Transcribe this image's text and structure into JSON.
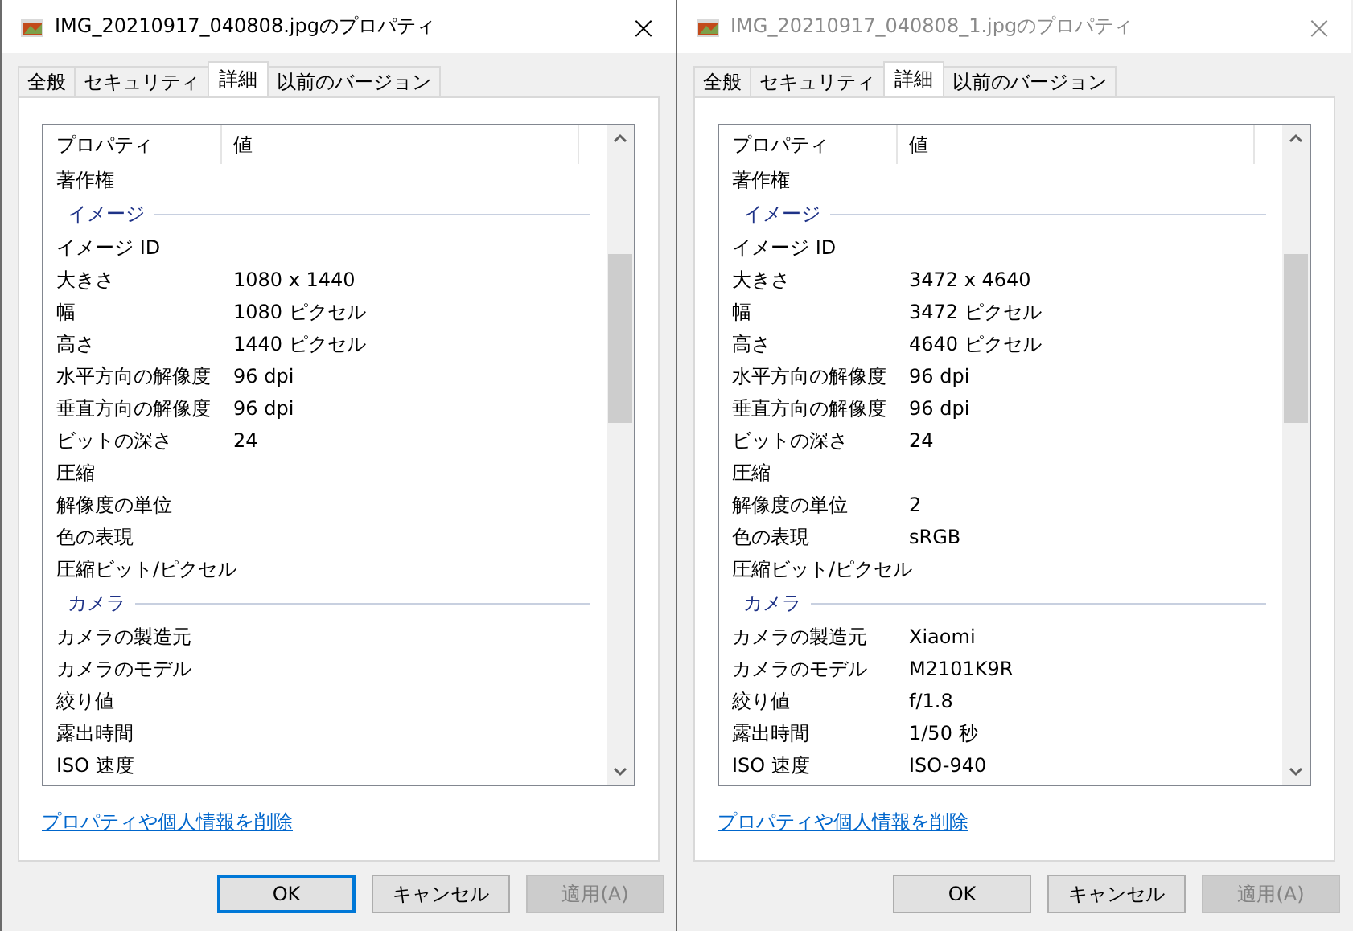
{
  "windows": [
    {
      "title": "IMG_20210917_040808.jpgのプロパティ",
      "active": true,
      "close": "×",
      "tabs": [
        {
          "label": "全般",
          "selected": false
        },
        {
          "label": "セキュリティ",
          "selected": false
        },
        {
          "label": "詳細",
          "selected": true
        },
        {
          "label": "以前のバージョン",
          "selected": false
        }
      ],
      "columns": [
        "プロパティ",
        "値"
      ],
      "rows": [
        {
          "kind": "row",
          "name": "著作権"
        },
        {
          "kind": "group",
          "name": "イメージ"
        },
        {
          "kind": "row",
          "name": "イメージ ID"
        },
        {
          "kind": "row",
          "name": "大きさ",
          "value": "1080 x 1440"
        },
        {
          "kind": "row",
          "name": "幅",
          "value": "1080 ピクセル"
        },
        {
          "kind": "row",
          "name": "高さ",
          "value": "1440 ピクセル"
        },
        {
          "kind": "row",
          "name": "水平方向の解像度",
          "value": "96 dpi"
        },
        {
          "kind": "row",
          "name": "垂直方向の解像度",
          "value": "96 dpi"
        },
        {
          "kind": "row",
          "name": "ビットの深さ",
          "value": "24"
        },
        {
          "kind": "row",
          "name": "圧縮"
        },
        {
          "kind": "row",
          "name": "解像度の単位"
        },
        {
          "kind": "row",
          "name": "色の表現"
        },
        {
          "kind": "row",
          "name": "圧縮ビット/ピクセル"
        },
        {
          "kind": "group",
          "name": "カメラ"
        },
        {
          "kind": "row",
          "name": "カメラの製造元"
        },
        {
          "kind": "row",
          "name": "カメラのモデル"
        },
        {
          "kind": "row",
          "name": "絞り値"
        },
        {
          "kind": "row",
          "name": "露出時間"
        },
        {
          "kind": "row",
          "name": "ISO 速度"
        }
      ],
      "link": "プロパティや個人情報を削除",
      "buttons": [
        {
          "label": "OK",
          "disabled": false,
          "default": true
        },
        {
          "label": "キャンセル",
          "disabled": false,
          "default": false
        },
        {
          "label": "適用(A)",
          "disabled": true,
          "default": false
        }
      ]
    },
    {
      "title": "IMG_20210917_040808_1.jpgのプロパティ",
      "active": false,
      "close": "×",
      "tabs": [
        {
          "label": "全般",
          "selected": false
        },
        {
          "label": "セキュリティ",
          "selected": false
        },
        {
          "label": "詳細",
          "selected": true
        },
        {
          "label": "以前のバージョン",
          "selected": false
        }
      ],
      "columns": [
        "プロパティ",
        "値"
      ],
      "rows": [
        {
          "kind": "row",
          "name": "著作権"
        },
        {
          "kind": "group",
          "name": "イメージ"
        },
        {
          "kind": "row",
          "name": "イメージ ID"
        },
        {
          "kind": "row",
          "name": "大きさ",
          "value": "3472 x 4640"
        },
        {
          "kind": "row",
          "name": "幅",
          "value": "3472 ピクセル"
        },
        {
          "kind": "row",
          "name": "高さ",
          "value": "4640 ピクセル"
        },
        {
          "kind": "row",
          "name": "水平方向の解像度",
          "value": "96 dpi"
        },
        {
          "kind": "row",
          "name": "垂直方向の解像度",
          "value": "96 dpi"
        },
        {
          "kind": "row",
          "name": "ビットの深さ",
          "value": "24"
        },
        {
          "kind": "row",
          "name": "圧縮"
        },
        {
          "kind": "row",
          "name": "解像度の単位",
          "value": "2"
        },
        {
          "kind": "row",
          "name": "色の表現",
          "value": "sRGB"
        },
        {
          "kind": "row",
          "name": "圧縮ビット/ピクセル"
        },
        {
          "kind": "group",
          "name": "カメラ"
        },
        {
          "kind": "row",
          "name": "カメラの製造元",
          "value": "Xiaomi"
        },
        {
          "kind": "row",
          "name": "カメラのモデル",
          "value": "M2101K9R"
        },
        {
          "kind": "row",
          "name": "絞り値",
          "value": "f/1.8"
        },
        {
          "kind": "row",
          "name": "露出時間",
          "value": "1/50 秒"
        },
        {
          "kind": "row",
          "name": "ISO 速度",
          "value": "ISO-940"
        }
      ],
      "link": "プロパティや個人情報を削除",
      "buttons": [
        {
          "label": "OK",
          "disabled": false,
          "default": false
        },
        {
          "label": "キャンセル",
          "disabled": false,
          "default": false
        },
        {
          "label": "適用(A)",
          "disabled": true,
          "default": false
        }
      ]
    }
  ]
}
